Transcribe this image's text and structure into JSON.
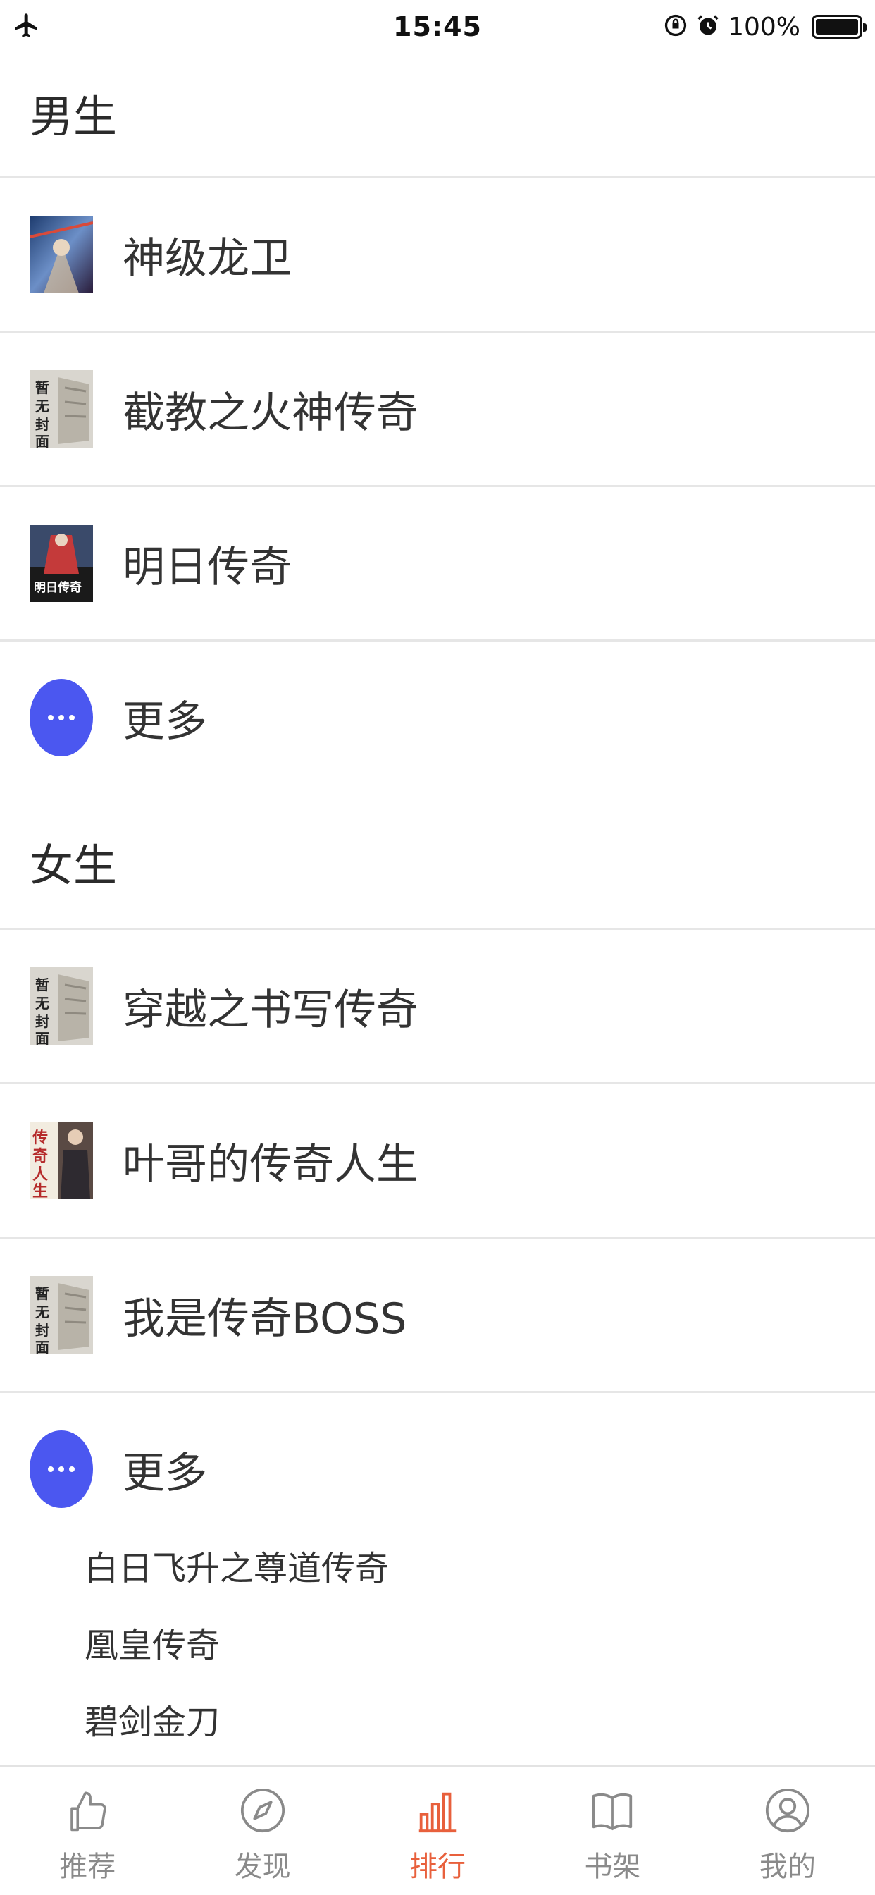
{
  "status_bar": {
    "time": "15:45",
    "battery_text": "100%",
    "icons": [
      "airplane-icon",
      "rotation-lock-icon",
      "alarm-icon",
      "battery-icon"
    ]
  },
  "sections": [
    {
      "title": "男生",
      "items": [
        {
          "title": "神级龙卫",
          "cover": "book-cover-image"
        },
        {
          "title": "截教之火神传奇",
          "cover": "no-cover-image",
          "cover_text": "暂无封面"
        },
        {
          "title": "明日传奇",
          "cover": "book-cover-image",
          "cover_text": "明日传奇"
        }
      ],
      "more_label": "更多"
    },
    {
      "title": "女生",
      "items": [
        {
          "title": "穿越之书写传奇",
          "cover": "no-cover-image",
          "cover_text": "暂无封面"
        },
        {
          "title": "叶哥的传奇人生",
          "cover": "book-cover-image",
          "cover_text": "传奇人生"
        },
        {
          "title": "我是传奇BOSS",
          "cover": "no-cover-image",
          "cover_text": "暂无封面"
        }
      ],
      "more_label": "更多",
      "more_links": [
        "白日飞升之尊道传奇",
        "凰皇传奇",
        "碧剑金刀"
      ]
    }
  ],
  "tab_bar": {
    "tabs": [
      {
        "label": "推荐",
        "icon": "thumbs-up-icon",
        "active": false
      },
      {
        "label": "发现",
        "icon": "compass-icon",
        "active": false
      },
      {
        "label": "排行",
        "icon": "bar-chart-icon",
        "active": true
      },
      {
        "label": "书架",
        "icon": "book-icon",
        "active": false
      },
      {
        "label": "我的",
        "icon": "user-icon",
        "active": false
      }
    ]
  },
  "colors": {
    "accent": "#e8603c",
    "more_button": "#4b57f0",
    "tab_inactive": "#8a8a8a",
    "divider": "#e6e6e6"
  }
}
